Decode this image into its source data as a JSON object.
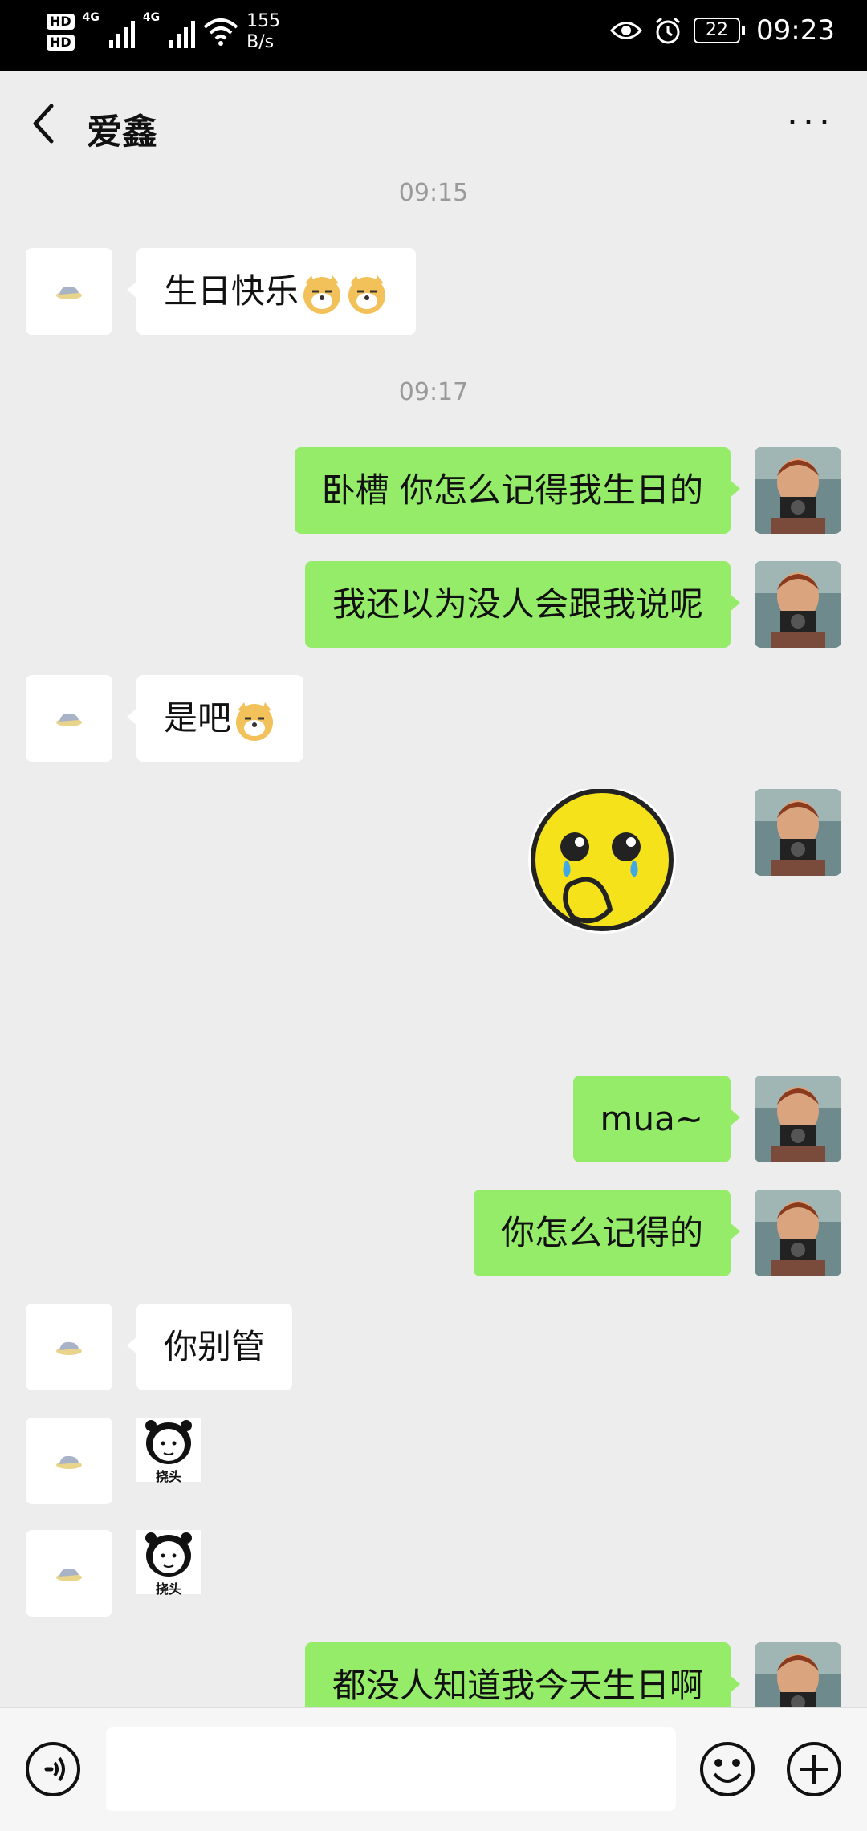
{
  "status_bar": {
    "hd1": "HD",
    "hd2": "HD",
    "network1": "4G",
    "network2": "4G",
    "speed_value": "155",
    "speed_unit": "B/s",
    "battery": "22",
    "time": "09:23"
  },
  "header": {
    "title": "爱鑫",
    "more": "···"
  },
  "messages": {
    "t1": "09:15",
    "m1": "生日快乐",
    "t2": "09:17",
    "m2": "卧槽 你怎么记得我生日的",
    "m3": "我还以为没人会跟我说呢",
    "m4": "是吧",
    "m6": "mua~",
    "m7": "你怎么记得的",
    "m8": "你别管",
    "sticker_caption": "挠头",
    "m11": "都没人知道我今天生日啊"
  },
  "icons": {
    "back": "chevron-left-icon",
    "voice": "voice-icon",
    "emoji": "emoji-icon",
    "add": "plus-icon"
  },
  "colors": {
    "outgoing_bubble": "#95ec69",
    "incoming_bubble": "#ffffff",
    "background": "#ededed"
  }
}
